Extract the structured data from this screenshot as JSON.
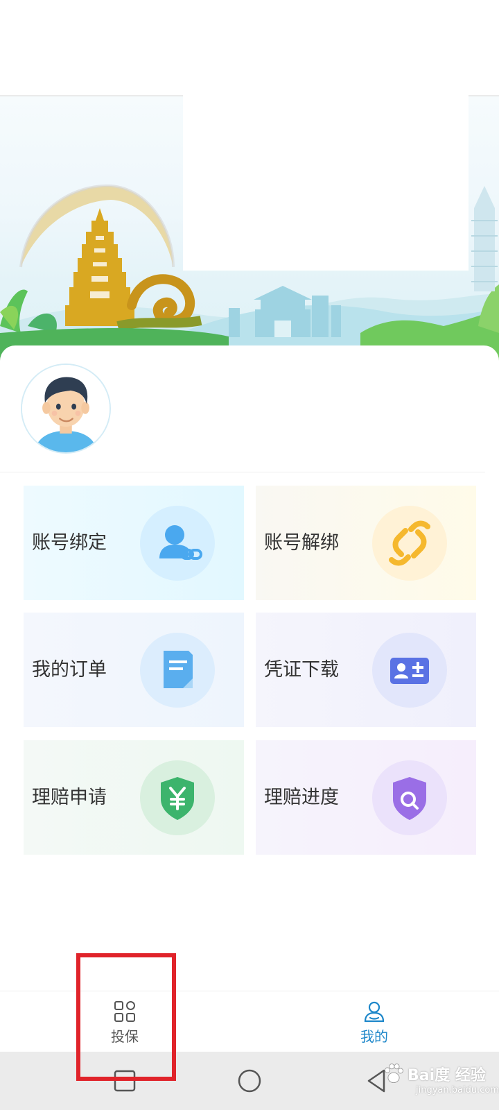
{
  "profile": {
    "avatar_icon": "boy-avatar-icon"
  },
  "menu": {
    "items": [
      {
        "label": "账号绑定",
        "icon": "user-link-icon",
        "color": "#4aa8ef"
      },
      {
        "label": "账号解绑",
        "icon": "unlink-icon",
        "color": "#f5b82e"
      },
      {
        "label": "我的订单",
        "icon": "document-icon",
        "color": "#5aaeee"
      },
      {
        "label": "凭证下载",
        "icon": "id-card-icon",
        "color": "#5a72e4"
      },
      {
        "label": "理赔申请",
        "icon": "shield-yen-icon",
        "color": "#3cb46c"
      },
      {
        "label": "理赔进度",
        "icon": "shield-search-icon",
        "color": "#9a6ee6"
      }
    ]
  },
  "bottom_nav": {
    "items": [
      {
        "label": "投保",
        "icon": "grid-icon",
        "active": false
      },
      {
        "label": "我的",
        "icon": "person-icon",
        "active": true
      }
    ],
    "active_color": "#1c86c9",
    "inactive_color": "#555555"
  },
  "annotation": {
    "color": "#e0232a"
  },
  "watermark": {
    "text": "Bai度 经验",
    "sub": "jingyan.baidu.com"
  }
}
